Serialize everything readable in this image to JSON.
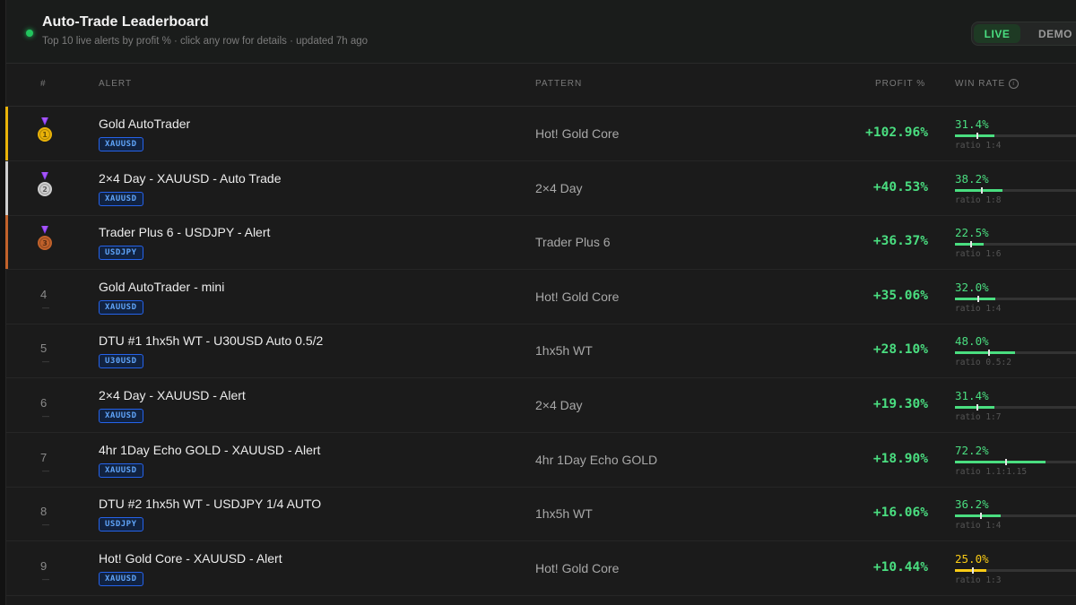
{
  "header": {
    "title": "Auto-Trade Leaderboard",
    "subtitle": "Top 10 live alerts by profit % · click any row for details · updated 7h ago",
    "modes": {
      "live": "LIVE",
      "demo": "DEMO"
    }
  },
  "columns": {
    "rank": "#",
    "alert": "ALERT",
    "pattern": "PATTERN",
    "profit": "PROFIT %",
    "winrate": "WIN RATE"
  },
  "colors": {
    "gold": "#eab308",
    "silver": "#cfcfcf",
    "bronze": "#c2622b",
    "green": "#4ade80",
    "yellow": "#facc15",
    "symbol_blue": "#60a5fa"
  },
  "rows": [
    {
      "rank": "1",
      "medal": "gold-medal-icon",
      "name": "Gold AutoTrader",
      "symbol": "XAUUSD",
      "pattern": "Hot! Gold Core",
      "profit": "+102.96%",
      "winrate": "31.4%",
      "winrate_value": 0.314,
      "ratio": "ratio 1:4"
    },
    {
      "rank": "2",
      "medal": "silver-medal-icon",
      "name": "2×4 Day - XAUUSD - Auto Trade",
      "symbol": "XAUUSD",
      "pattern": "2×4 Day",
      "profit": "+40.53%",
      "winrate": "38.2%",
      "winrate_value": 0.382,
      "ratio": "ratio 1:8"
    },
    {
      "rank": "3",
      "medal": "bronze-medal-icon",
      "name": "Trader Plus 6 - USDJPY - Alert",
      "symbol": "USDJPY",
      "pattern": "Trader Plus 6",
      "profit": "+36.37%",
      "winrate": "22.5%",
      "winrate_value": 0.225,
      "ratio": "ratio 1:6"
    },
    {
      "rank": "4",
      "name": "Gold AutoTrader - mini",
      "symbol": "XAUUSD",
      "pattern": "Hot! Gold Core",
      "profit": "+35.06%",
      "winrate": "32.0%",
      "winrate_value": 0.32,
      "ratio": "ratio 1:4"
    },
    {
      "rank": "5",
      "name": "DTU #1 1hx5h WT - U30USD Auto 0.5/2",
      "symbol": "U30USD",
      "pattern": "1hx5h WT",
      "profit": "+28.10%",
      "winrate": "48.0%",
      "winrate_value": 0.48,
      "ratio": "ratio 0.5:2"
    },
    {
      "rank": "6",
      "name": "2×4 Day - XAUUSD - Alert",
      "symbol": "XAUUSD",
      "pattern": "2×4 Day",
      "profit": "+19.30%",
      "winrate": "31.4%",
      "winrate_value": 0.314,
      "ratio": "ratio 1:7"
    },
    {
      "rank": "7",
      "name": "4hr 1Day Echo GOLD - XAUUSD - Alert",
      "symbol": "XAUUSD",
      "pattern": "4hr 1Day Echo GOLD",
      "profit": "+18.90%",
      "winrate": "72.2%",
      "winrate_value": 0.722,
      "ratio": "ratio 1.1:1.15"
    },
    {
      "rank": "8",
      "name": "DTU #2 1hx5h WT - USDJPY 1/4 AUTO",
      "symbol": "USDJPY",
      "pattern": "1hx5h WT",
      "profit": "+16.06%",
      "winrate": "36.2%",
      "winrate_value": 0.362,
      "ratio": "ratio 1:4"
    },
    {
      "rank": "9",
      "name": "Hot! Gold Core - XAUUSD - Alert",
      "symbol": "XAUUSD",
      "pattern": "Hot! Gold Core",
      "profit": "+10.44%",
      "winrate": "25.0%",
      "winrate_value": 0.25,
      "ratio": "ratio 1:3",
      "winrate_color": "yellow"
    }
  ]
}
